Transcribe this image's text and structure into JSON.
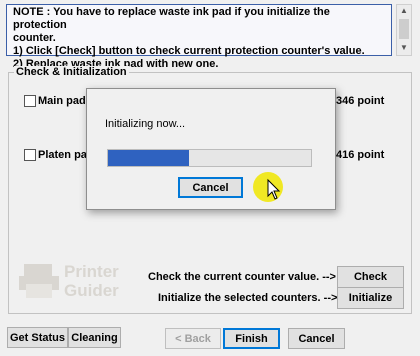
{
  "note": {
    "line1": "NOTE : You have to replace waste ink pad if you initialize the protection",
    "line2": "counter.",
    "line3": "1) Click [Check] button to check current protection counter's value.",
    "line4": "2) Replace waste ink pad with new one."
  },
  "group": {
    "title": "Check & Initialization",
    "main_pad_label": "Main pad",
    "main_pad_value": "346 point",
    "platen_pad_label": "Platen pa",
    "platen_pad_value": "416 point",
    "check_hint": "Check the current counter value. -->",
    "init_hint": "Initialize the selected counters. -->",
    "check_button": "Check",
    "initialize_button": "Initialize"
  },
  "watermark": {
    "line1": "Printer",
    "line2": "Guider"
  },
  "footer": {
    "get_status": "Get Status",
    "cleaning": "Cleaning",
    "back": "< Back",
    "finish": "Finish",
    "cancel": "Cancel"
  },
  "dialog": {
    "status_text": "Initializing now...",
    "progress": 0.4,
    "cancel_button": "Cancel"
  },
  "colors": {
    "accent": "#0078d7",
    "progress": "#2f62c0",
    "note_border": "#3b5fa8",
    "cursor": "#f0e600"
  }
}
